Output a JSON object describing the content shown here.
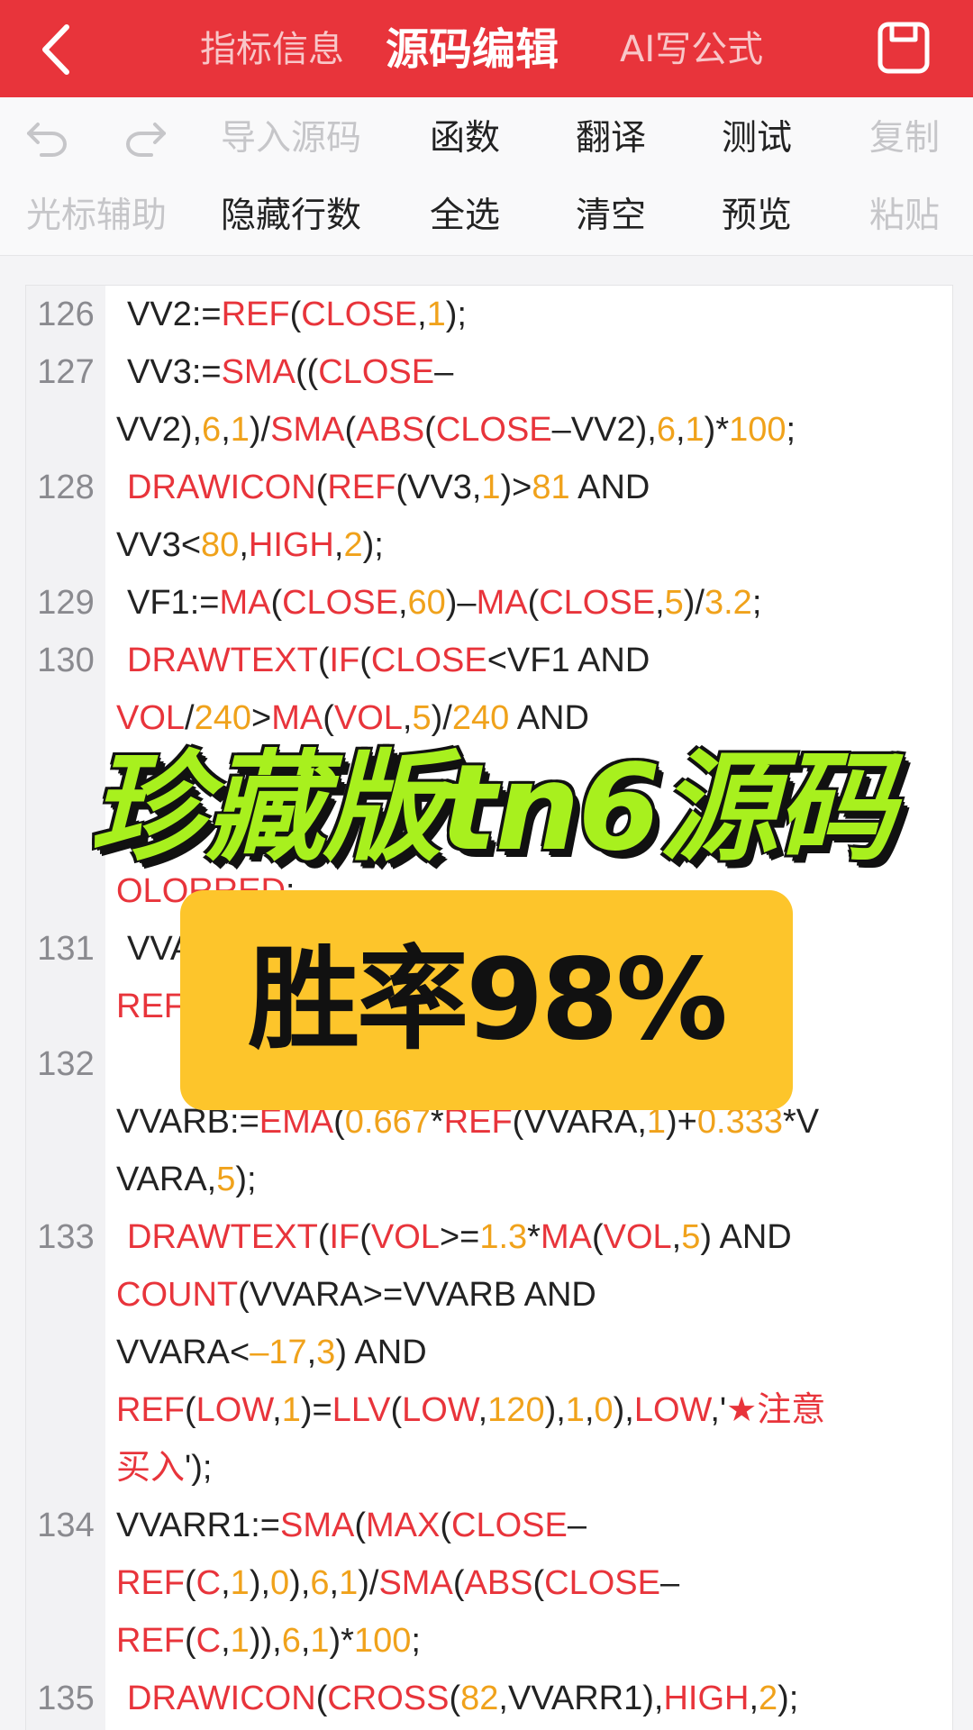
{
  "header": {
    "tabs": [
      {
        "label": "指标信息"
      },
      {
        "label": "源码编辑"
      },
      {
        "label": "AI写公式"
      }
    ],
    "icons": {
      "back": "chevron-left-icon",
      "save": "floppy-disk-icon"
    }
  },
  "toolbar": {
    "row1": [
      {
        "label": "导入源码"
      },
      {
        "label": "函数"
      },
      {
        "label": "翻译"
      },
      {
        "label": "测试"
      },
      {
        "label": "复制"
      }
    ],
    "row2": [
      {
        "label": "光标辅助"
      },
      {
        "label": "隐藏行数"
      },
      {
        "label": "全选"
      },
      {
        "label": "清空"
      },
      {
        "label": "预览"
      },
      {
        "label": "粘贴"
      }
    ],
    "icons": {
      "undo": "undo-icon",
      "redo": "redo-icon"
    }
  },
  "editor": {
    "lines": [
      {
        "n": "126",
        "indent": true,
        "segs": [
          [
            "VV2:=",
            "t"
          ],
          [
            "REF",
            "f"
          ],
          [
            "(",
            "t"
          ],
          [
            "CLOSE",
            "f"
          ],
          [
            ",",
            "t"
          ],
          [
            "1",
            "n"
          ],
          [
            ");",
            "t"
          ]
        ]
      },
      {
        "n": "127",
        "indent": true,
        "segs": [
          [
            "VV3:=",
            "t"
          ],
          [
            "SMA",
            "f"
          ],
          [
            "((",
            "t"
          ],
          [
            "CLOSE",
            "f"
          ],
          [
            "–",
            "t"
          ]
        ]
      },
      {
        "n": "",
        "indent": false,
        "segs": [
          [
            "VV2),",
            "t"
          ],
          [
            "6",
            "n"
          ],
          [
            ",",
            "t"
          ],
          [
            "1",
            "n"
          ],
          [
            ")/",
            "t"
          ],
          [
            "SMA",
            "f"
          ],
          [
            "(",
            "t"
          ],
          [
            "ABS",
            "f"
          ],
          [
            "(",
            "t"
          ],
          [
            "CLOSE",
            "f"
          ],
          [
            "–VV2),",
            "t"
          ],
          [
            "6",
            "n"
          ],
          [
            ",",
            "t"
          ],
          [
            "1",
            "n"
          ],
          [
            ")*",
            "t"
          ],
          [
            "100",
            "n"
          ],
          [
            ";",
            "t"
          ]
        ]
      },
      {
        "n": "128",
        "indent": true,
        "segs": [
          [
            "DRAWICON",
            "f"
          ],
          [
            "(",
            "t"
          ],
          [
            "REF",
            "f"
          ],
          [
            "(VV3,",
            "t"
          ],
          [
            "1",
            "n"
          ],
          [
            ")>",
            "t"
          ],
          [
            "81",
            "n"
          ],
          [
            " AND",
            "t"
          ]
        ]
      },
      {
        "n": "",
        "indent": false,
        "segs": [
          [
            "VV3<",
            "t"
          ],
          [
            "80",
            "n"
          ],
          [
            ",",
            "t"
          ],
          [
            "HIGH",
            "f"
          ],
          [
            ",",
            "t"
          ],
          [
            "2",
            "n"
          ],
          [
            ");",
            "t"
          ]
        ]
      },
      {
        "n": "129",
        "indent": true,
        "segs": [
          [
            "VF1:=",
            "t"
          ],
          [
            "MA",
            "f"
          ],
          [
            "(",
            "t"
          ],
          [
            "CLOSE",
            "f"
          ],
          [
            ",",
            "t"
          ],
          [
            "60",
            "n"
          ],
          [
            ")–",
            "t"
          ],
          [
            "MA",
            "f"
          ],
          [
            "(",
            "t"
          ],
          [
            "CLOSE",
            "f"
          ],
          [
            ",",
            "t"
          ],
          [
            "5",
            "n"
          ],
          [
            ")/",
            "t"
          ],
          [
            "3.2",
            "n"
          ],
          [
            ";",
            "t"
          ]
        ]
      },
      {
        "n": "130",
        "indent": true,
        "segs": [
          [
            "DRAWTEXT",
            "f"
          ],
          [
            "(",
            "t"
          ],
          [
            "IF",
            "f"
          ],
          [
            "(",
            "t"
          ],
          [
            "CLOSE",
            "f"
          ],
          [
            "<VF1 AND",
            "t"
          ]
        ]
      },
      {
        "n": "",
        "indent": false,
        "segs": [
          [
            "VOL",
            "f"
          ],
          [
            "/",
            "t"
          ],
          [
            "240",
            "n"
          ],
          [
            ">",
            "t"
          ],
          [
            "MA",
            "f"
          ],
          [
            "(",
            "t"
          ],
          [
            "VOL",
            "f"
          ],
          [
            ",",
            "t"
          ],
          [
            "5",
            "n"
          ],
          [
            ")/",
            "t"
          ],
          [
            "240",
            "n"
          ],
          [
            " AND",
            "t"
          ]
        ]
      },
      {
        "n": "",
        "indent": false,
        "segs": []
      },
      {
        "n": "",
        "indent": false,
        "segs": []
      },
      {
        "n": "",
        "indent": false,
        "segs": [
          [
            "OLORRED",
            "f"
          ],
          [
            ";",
            "t"
          ]
        ]
      },
      {
        "n": "131",
        "indent": true,
        "segs": [
          [
            "VVA",
            "t"
          ]
        ]
      },
      {
        "n": "",
        "indent": false,
        "segs": [
          [
            "REF",
            "f"
          ]
        ]
      },
      {
        "n": "132",
        "indent": false,
        "segs": []
      },
      {
        "n": "",
        "indent": false,
        "segs": [
          [
            "VVARB:=",
            "t"
          ],
          [
            "EMA",
            "f"
          ],
          [
            "(",
            "t"
          ],
          [
            "0.667",
            "n"
          ],
          [
            "*",
            "t"
          ],
          [
            "REF",
            "f"
          ],
          [
            "(VVARA,",
            "t"
          ],
          [
            "1",
            "n"
          ],
          [
            ")+",
            "t"
          ],
          [
            "0.333",
            "n"
          ],
          [
            "*V",
            "t"
          ]
        ]
      },
      {
        "n": "",
        "indent": false,
        "segs": [
          [
            "VARA,",
            "t"
          ],
          [
            "5",
            "n"
          ],
          [
            ");",
            "t"
          ]
        ]
      },
      {
        "n": "133",
        "indent": true,
        "segs": [
          [
            "DRAWTEXT",
            "f"
          ],
          [
            "(",
            "t"
          ],
          [
            "IF",
            "f"
          ],
          [
            "(",
            "t"
          ],
          [
            "VOL",
            "f"
          ],
          [
            ">=",
            "t"
          ],
          [
            "1.3",
            "n"
          ],
          [
            "*",
            "t"
          ],
          [
            "MA",
            "f"
          ],
          [
            "(",
            "t"
          ],
          [
            "VOL",
            "f"
          ],
          [
            ",",
            "t"
          ],
          [
            "5",
            "n"
          ],
          [
            ") AND",
            "t"
          ]
        ]
      },
      {
        "n": "",
        "indent": false,
        "segs": [
          [
            "COUNT",
            "f"
          ],
          [
            "(VVARA>=VVARB AND",
            "t"
          ]
        ]
      },
      {
        "n": "",
        "indent": false,
        "segs": [
          [
            "VVARA<",
            "t"
          ],
          [
            "–17",
            "n"
          ],
          [
            ",",
            "t"
          ],
          [
            "3",
            "n"
          ],
          [
            ") AND",
            "t"
          ]
        ]
      },
      {
        "n": "",
        "indent": false,
        "segs": [
          [
            "REF",
            "f"
          ],
          [
            "(",
            "t"
          ],
          [
            "LOW",
            "f"
          ],
          [
            ",",
            "t"
          ],
          [
            "1",
            "n"
          ],
          [
            ")=",
            "t"
          ],
          [
            "LLV",
            "f"
          ],
          [
            "(",
            "t"
          ],
          [
            "LOW",
            "f"
          ],
          [
            ",",
            "t"
          ],
          [
            "120",
            "n"
          ],
          [
            "),",
            "t"
          ],
          [
            "1",
            "n"
          ],
          [
            ",",
            "t"
          ],
          [
            "0",
            "n"
          ],
          [
            "),",
            "t"
          ],
          [
            "LOW",
            "f"
          ],
          [
            ",'",
            "t"
          ],
          [
            "★注意",
            "f"
          ]
        ]
      },
      {
        "n": "",
        "indent": false,
        "segs": [
          [
            "买入",
            "f"
          ],
          [
            "');",
            "t"
          ]
        ]
      },
      {
        "n": "134",
        "indent": false,
        "segs": [
          [
            "VVARR1:=",
            "t"
          ],
          [
            "SMA",
            "f"
          ],
          [
            "(",
            "t"
          ],
          [
            "MAX",
            "f"
          ],
          [
            "(",
            "t"
          ],
          [
            "CLOSE",
            "f"
          ],
          [
            "–",
            "t"
          ]
        ]
      },
      {
        "n": "",
        "indent": false,
        "segs": [
          [
            "REF",
            "f"
          ],
          [
            "(",
            "t"
          ],
          [
            "C",
            "f"
          ],
          [
            ",",
            "t"
          ],
          [
            "1",
            "n"
          ],
          [
            "),",
            "t"
          ],
          [
            "0",
            "n"
          ],
          [
            "),",
            "t"
          ],
          [
            "6",
            "n"
          ],
          [
            ",",
            "t"
          ],
          [
            "1",
            "n"
          ],
          [
            ")/",
            "t"
          ],
          [
            "SMA",
            "f"
          ],
          [
            "(",
            "t"
          ],
          [
            "ABS",
            "f"
          ],
          [
            "(",
            "t"
          ],
          [
            "CLOSE",
            "f"
          ],
          [
            "–",
            "t"
          ]
        ]
      },
      {
        "n": "",
        "indent": false,
        "segs": [
          [
            "REF",
            "f"
          ],
          [
            "(",
            "t"
          ],
          [
            "C",
            "f"
          ],
          [
            ",",
            "t"
          ],
          [
            "1",
            "n"
          ],
          [
            ")),",
            "t"
          ],
          [
            "6",
            "n"
          ],
          [
            ",",
            "t"
          ],
          [
            "1",
            "n"
          ],
          [
            ")*",
            "t"
          ],
          [
            "100",
            "n"
          ],
          [
            ";",
            "t"
          ]
        ]
      },
      {
        "n": "135",
        "indent": true,
        "segs": [
          [
            "DRAWICON",
            "f"
          ],
          [
            "(",
            "t"
          ],
          [
            "CROSS",
            "f"
          ],
          [
            "(",
            "t"
          ],
          [
            "82",
            "n"
          ],
          [
            ",VVARR1),",
            "t"
          ],
          [
            "HIGH",
            "f"
          ],
          [
            ",",
            "t"
          ],
          [
            "2",
            "n"
          ],
          [
            ");",
            "t"
          ]
        ]
      }
    ]
  },
  "overlay": {
    "title": "珍藏版tn6源码",
    "rate": "胜率98%"
  },
  "colors": {
    "header_red": "#e8343b",
    "function_red": "#e8343b",
    "number_orange": "#f0a21b",
    "title_green": "#a8f01e",
    "badge_yellow": "#fdc52b"
  }
}
